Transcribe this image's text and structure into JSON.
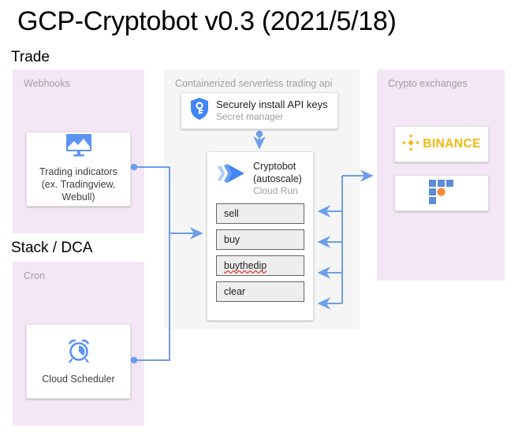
{
  "title": "GCP-Cryptobot v0.3 (2021/5/18)",
  "sections": {
    "trade": "Trade",
    "stack_dca": "Stack / DCA"
  },
  "panels": {
    "webhooks": {
      "label": "Webhooks"
    },
    "container": {
      "label": "Containerized serverless trading api"
    },
    "exchanges": {
      "label": "Crypto exchanges"
    },
    "cron": {
      "label": "Cron"
    }
  },
  "nodes": {
    "trading_indicators": {
      "icon": "monitor-chart-icon",
      "label": "Trading indicators (ex. Tradingview, Webull)"
    },
    "cloud_scheduler": {
      "icon": "alarm-clock-icon",
      "label": "Cloud Scheduler"
    },
    "secret_manager": {
      "icon": "shield-key-icon",
      "title": "Securely install API keys",
      "subtitle": "Secret manager"
    },
    "cryptobot": {
      "icon": "cloud-run-icon",
      "title_line1": "Cryptobot",
      "title_line2": "(autoscale)",
      "subtitle": "Cloud Run",
      "commands": [
        {
          "label": "sell",
          "misspelled": false
        },
        {
          "label": "buy",
          "misspelled": false
        },
        {
          "label": "buythedip",
          "misspelled": true
        },
        {
          "label": "clear",
          "misspelled": false
        }
      ]
    },
    "binance": {
      "icon": "binance-logo",
      "label": "BINANCE"
    },
    "ftx": {
      "icon": "ftx-logo",
      "label": ""
    }
  },
  "colors": {
    "panel_lavender": "#f3e6f5",
    "panel_gray": "#f5f5f5",
    "connector_blue": "#6d9eeb",
    "icon_blue": "#5c92f2",
    "binance_gold": "#f0b90b",
    "ftx_blue": "#5b8dd9",
    "ftx_orange": "#f28b41",
    "command_box_bg": "#eeeeee",
    "spellcheck_red": "#e53935"
  }
}
